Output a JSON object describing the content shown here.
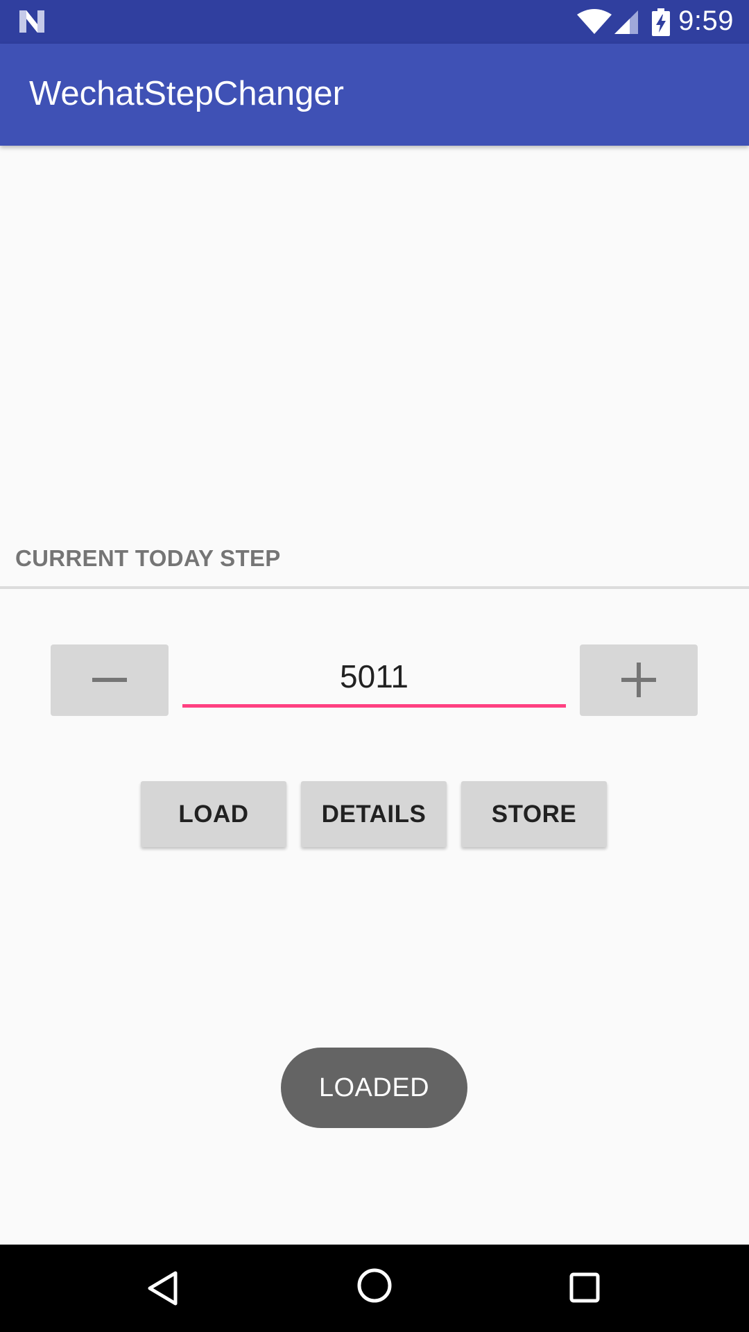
{
  "status_bar": {
    "time": "9:59",
    "icons": [
      "android-n-icon",
      "wifi-icon",
      "cell-signal-icon",
      "battery-charging-icon"
    ]
  },
  "app_bar": {
    "title": "WechatStepChanger",
    "color": "#3f51b5",
    "status_color": "#303f9f"
  },
  "main": {
    "section_header": "CURRENT TODAY STEP",
    "stepper": {
      "value": "5011",
      "decrement_icon": "minus-icon",
      "increment_icon": "plus-icon",
      "accent_color": "#ff4081"
    },
    "actions": {
      "load_label": "LOAD",
      "details_label": "DETAILS",
      "store_label": "STORE"
    }
  },
  "toast": {
    "message": "LOADED"
  },
  "nav_bar": {
    "icons": [
      "back-icon",
      "home-icon",
      "recents-icon"
    ]
  }
}
